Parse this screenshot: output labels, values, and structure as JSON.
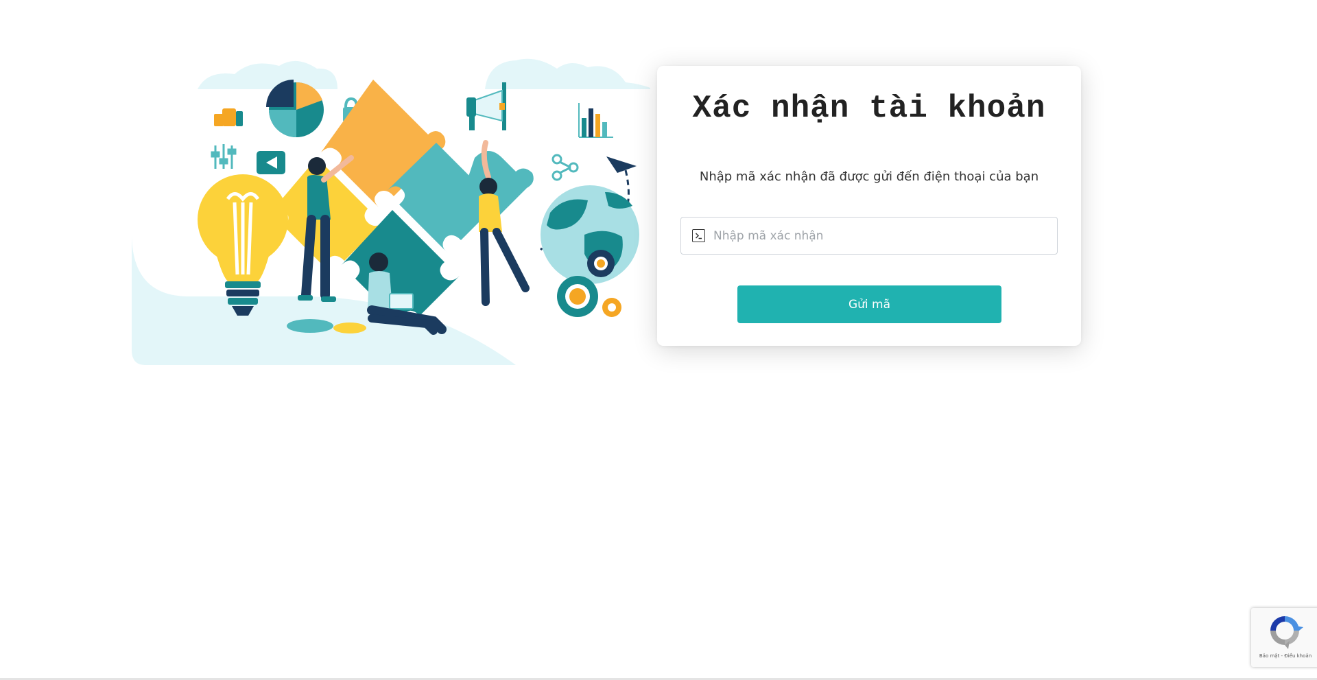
{
  "card": {
    "title": "Xác nhận tài khoản",
    "description": "Nhập mã xác nhận đã được gửi đến điện thoại của bạn",
    "code_input": {
      "placeholder": "Nhập mã xác nhận",
      "value": ""
    },
    "send_button_label": "Gửi mã"
  },
  "recaptcha": {
    "footer": "Bảo mật - Điều khoản"
  },
  "illustration": {
    "name": "teamwork-puzzle-illustration",
    "icons": [
      "thumbs-up-icon",
      "pie-chart-icon",
      "lock-icon",
      "sliders-icon",
      "play-icon",
      "megaphone-icon",
      "bar-chart-icon",
      "share-icon",
      "globe-icon",
      "paper-plane-icon",
      "gear-icon",
      "light-bulb-icon"
    ]
  },
  "colors": {
    "accent": "#20b2b0",
    "puzzle_orange": "#f9b248",
    "puzzle_yellow": "#fcd23a",
    "puzzle_teal": "#188a8d",
    "puzzle_light_teal": "#52b9bd",
    "background_tint": "#e3f6f9"
  }
}
